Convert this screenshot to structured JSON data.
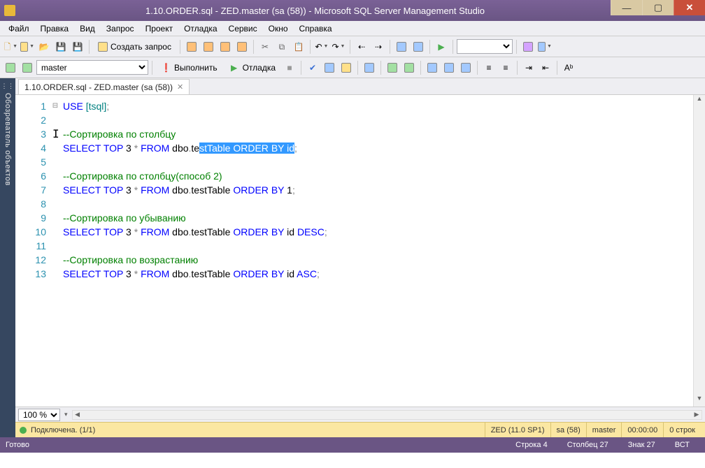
{
  "title": "1.10.ORDER.sql - ZED.master (sa (58)) - Microsoft SQL Server Management Studio",
  "menu": [
    "Файл",
    "Правка",
    "Вид",
    "Запрос",
    "Проект",
    "Отладка",
    "Сервис",
    "Окно",
    "Справка"
  ],
  "toolbar1": {
    "new_query": "Создать запрос"
  },
  "toolbar2": {
    "db": "master",
    "execute": "Выполнить",
    "debug": "Отладка"
  },
  "sidebar": "Обозреватель объектов",
  "tab": "1.10.ORDER.sql - ZED.master (sa (58))",
  "editor": {
    "lines": [
      {
        "n": 1,
        "tokens": [
          {
            "t": "USE",
            "c": "kw"
          },
          {
            "t": " "
          },
          {
            "t": "[tsql]",
            "c": "obj"
          },
          {
            "t": ";",
            "c": "gr"
          }
        ],
        "outline": "⊟"
      },
      {
        "n": 2,
        "tokens": []
      },
      {
        "n": 3,
        "tokens": [
          {
            "t": "--Сортировка по столбцу",
            "c": "cm"
          }
        ]
      },
      {
        "n": 4,
        "tokens": [
          {
            "t": "SELECT",
            "c": "kw"
          },
          {
            "t": " "
          },
          {
            "t": "TOP",
            "c": "kw"
          },
          {
            "t": " 3 "
          },
          {
            "t": "*",
            "c": "gr"
          },
          {
            "t": " "
          },
          {
            "t": "FROM",
            "c": "kw"
          },
          {
            "t": " dbo"
          },
          {
            "t": ".",
            "c": "gr"
          },
          {
            "t": "te"
          },
          {
            "t": "stTable ",
            "c": "sel"
          },
          {
            "t": "ORDER",
            "c": "kw sel"
          },
          {
            "t": " ",
            "c": "sel"
          },
          {
            "t": "BY",
            "c": "kw sel"
          },
          {
            "t": " id",
            "c": "sel"
          },
          {
            "t": ";",
            "c": "gr"
          }
        ]
      },
      {
        "n": 5,
        "tokens": []
      },
      {
        "n": 6,
        "tokens": [
          {
            "t": "--Сортировка по столбцу(способ 2)",
            "c": "cm"
          }
        ]
      },
      {
        "n": 7,
        "tokens": [
          {
            "t": "SELECT",
            "c": "kw"
          },
          {
            "t": " "
          },
          {
            "t": "TOP",
            "c": "kw"
          },
          {
            "t": " 3 "
          },
          {
            "t": "*",
            "c": "gr"
          },
          {
            "t": " "
          },
          {
            "t": "FROM",
            "c": "kw"
          },
          {
            "t": " dbo"
          },
          {
            "t": ".",
            "c": "gr"
          },
          {
            "t": "testTable "
          },
          {
            "t": "ORDER",
            "c": "kw"
          },
          {
            "t": " "
          },
          {
            "t": "BY",
            "c": "kw"
          },
          {
            "t": " 1"
          },
          {
            "t": ";",
            "c": "gr"
          }
        ]
      },
      {
        "n": 8,
        "tokens": []
      },
      {
        "n": 9,
        "tokens": [
          {
            "t": "--Сортировка по убыванию",
            "c": "cm"
          }
        ]
      },
      {
        "n": 10,
        "tokens": [
          {
            "t": "SELECT",
            "c": "kw"
          },
          {
            "t": " "
          },
          {
            "t": "TOP",
            "c": "kw"
          },
          {
            "t": " 3 "
          },
          {
            "t": "*",
            "c": "gr"
          },
          {
            "t": " "
          },
          {
            "t": "FROM",
            "c": "kw"
          },
          {
            "t": " dbo"
          },
          {
            "t": ".",
            "c": "gr"
          },
          {
            "t": "testTable "
          },
          {
            "t": "ORDER",
            "c": "kw"
          },
          {
            "t": " "
          },
          {
            "t": "BY",
            "c": "kw"
          },
          {
            "t": " id "
          },
          {
            "t": "DESC",
            "c": "kw"
          },
          {
            "t": ";",
            "c": "gr"
          }
        ]
      },
      {
        "n": 11,
        "tokens": []
      },
      {
        "n": 12,
        "tokens": [
          {
            "t": "--Сортировка по возрастанию",
            "c": "cm"
          }
        ]
      },
      {
        "n": 13,
        "tokens": [
          {
            "t": "SELECT",
            "c": "kw"
          },
          {
            "t": " "
          },
          {
            "t": "TOP",
            "c": "kw"
          },
          {
            "t": " 3 "
          },
          {
            "t": "*",
            "c": "gr"
          },
          {
            "t": " "
          },
          {
            "t": "FROM",
            "c": "kw"
          },
          {
            "t": " dbo"
          },
          {
            "t": ".",
            "c": "gr"
          },
          {
            "t": "testTable "
          },
          {
            "t": "ORDER",
            "c": "kw"
          },
          {
            "t": " "
          },
          {
            "t": "BY",
            "c": "kw"
          },
          {
            "t": " id "
          },
          {
            "t": "ASC",
            "c": "kw"
          },
          {
            "t": ";",
            "c": "gr"
          }
        ]
      }
    ],
    "zoom": "100 %"
  },
  "status1": {
    "conn": "Подключена. (1/1)",
    "server": "ZED (11.0 SP1)",
    "user": "sa (58)",
    "db": "master",
    "time": "00:00:00",
    "rows": "0 строк"
  },
  "status2": {
    "ready": "Готово",
    "line": "Строка 4",
    "col": "Столбец 27",
    "char": "Знак 27",
    "ins": "ВСТ"
  }
}
